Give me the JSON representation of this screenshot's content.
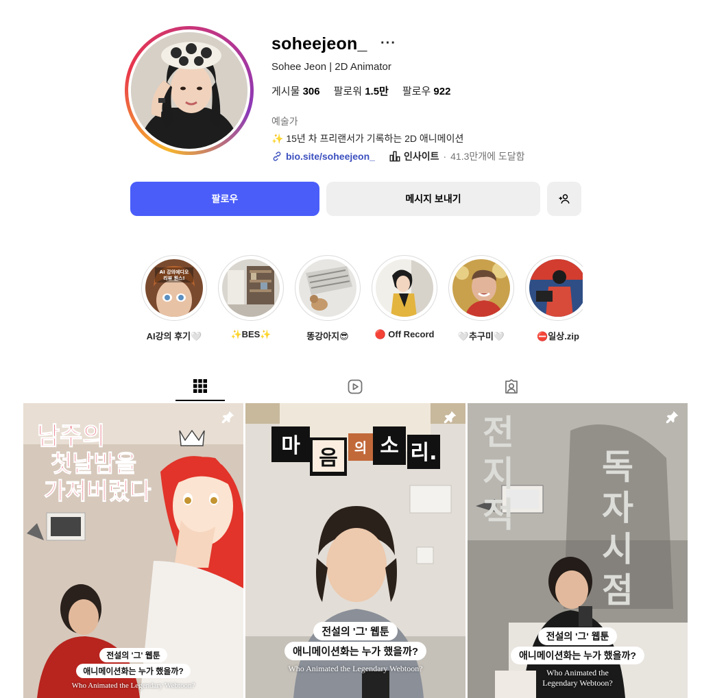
{
  "profile": {
    "username": "soheejeon_",
    "more": "···",
    "full_name": "Sohee Jeon | 2D Animator",
    "stats": {
      "posts_label": "게시물",
      "posts_value": "306",
      "followers_label": "팔로워",
      "followers_value": "1.5만",
      "following_label": "팔로우",
      "following_value": "922"
    },
    "category": "예술가",
    "bio_spark": "✨",
    "bio": "15년 차 프리랜서가 기록하는 2D 애니메이션",
    "bio_link": "bio.site/soheejeon_",
    "insights_label": "인사이트",
    "separator": "·",
    "reach": "41.3만개에 도달함"
  },
  "actions": {
    "follow": "팔로우",
    "message": "메시지 보내기",
    "suggest": "+옹"
  },
  "highlights": [
    {
      "label": "AI강의 후기🤍",
      "overlay": "AI 강의에디오 리뷰 원스!"
    },
    {
      "label": "✨BES✨"
    },
    {
      "label": "똥강아지😎"
    },
    {
      "label": "🔴 Off Record"
    },
    {
      "label": "🤍추구미🤍"
    },
    {
      "label": "⛔일상.zip"
    }
  ],
  "tabs": {
    "posts": "grid-icon",
    "reels": "reels-icon",
    "tagged": "tagged-icon"
  },
  "posts": [
    {
      "title_art": "남주의 첫날밤을 가져버렸다",
      "caption_1": "전설의 '그' 웹툰",
      "caption_2": "애니메이션화는 누가 했을까?",
      "caption_en": "Who Animated the Legendary Webtoon?"
    },
    {
      "title_art": "마음의 소리.",
      "caption_1": "전설의 '그' 웹툰",
      "caption_2": "애니메이션화는 누가 했을까?",
      "caption_en": "Who Animated the Legendary Webtoon?"
    },
    {
      "title_art": "전지적 독자 시점",
      "caption_1": "전설의 '그' 웹툰",
      "caption_2": "애니메이션화는 누가 했을까?",
      "caption_en_1": "Who Animated the",
      "caption_en_2": "Legendary Webtoon?"
    }
  ],
  "colors": {
    "primary_button": "#4a5df9",
    "secondary_button": "#efefef",
    "link": "#3b4fbf",
    "muted_text": "#737373"
  }
}
